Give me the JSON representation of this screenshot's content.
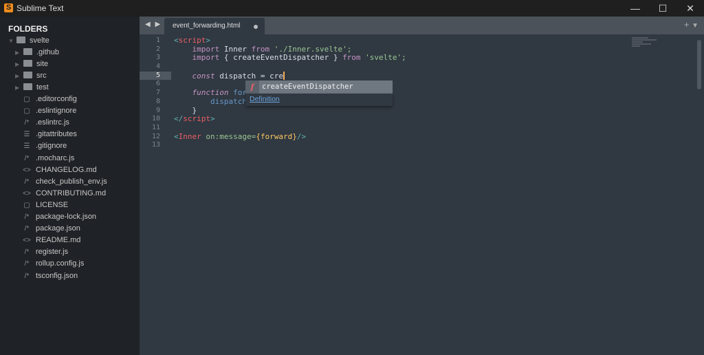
{
  "window": {
    "title": "Sublime Text",
    "minimize": "—",
    "maximize": "☐",
    "close": "✕"
  },
  "sidebar": {
    "header": "FOLDERS",
    "root": "svelte",
    "folders": [
      ".github",
      "site",
      "src",
      "test"
    ],
    "files": [
      {
        "name": ".editorconfig",
        "icon": "file-icon"
      },
      {
        "name": ".eslintignore",
        "icon": "file-icon"
      },
      {
        "name": ".eslintrc.js",
        "icon": "comment-icon"
      },
      {
        "name": ".gitattributes",
        "icon": "list-icon"
      },
      {
        "name": ".gitignore",
        "icon": "list-icon"
      },
      {
        "name": ".mocharc.js",
        "icon": "comment-icon"
      },
      {
        "name": "CHANGELOG.md",
        "icon": "code-icon"
      },
      {
        "name": "check_publish_env.js",
        "icon": "comment-icon"
      },
      {
        "name": "CONTRIBUTING.md",
        "icon": "code-icon"
      },
      {
        "name": "LICENSE",
        "icon": "file-icon"
      },
      {
        "name": "package-lock.json",
        "icon": "comment-icon"
      },
      {
        "name": "package.json",
        "icon": "comment-icon"
      },
      {
        "name": "README.md",
        "icon": "code-icon"
      },
      {
        "name": "register.js",
        "icon": "comment-icon"
      },
      {
        "name": "rollup.config.js",
        "icon": "comment-icon"
      },
      {
        "name": "tsconfig.json",
        "icon": "comment-icon"
      }
    ]
  },
  "tabs": {
    "nav": "◀ ▶",
    "active": "event_forwarding.html",
    "add": "+",
    "menu": "▼"
  },
  "editor": {
    "line_numbers": [
      "1",
      "2",
      "3",
      "4",
      "5",
      "6",
      "7",
      "8",
      "9",
      "10",
      "11",
      "12",
      "13"
    ],
    "current_line": "5",
    "code": {
      "l1": [
        "<",
        "script",
        ">"
      ],
      "l2": [
        "    ",
        "import",
        " Inner ",
        "from",
        " './Inner.svelte';"
      ],
      "l3": [
        "    ",
        "import",
        " { createEventDispatcher } ",
        "from",
        " 'svelte';"
      ],
      "l5": [
        "    ",
        "const",
        " dispatch = cre"
      ],
      "l7": [
        "    ",
        "function",
        " ",
        "forw"
      ],
      "l8": [
        "        dispatch("
      ],
      "l9": [
        "    }"
      ],
      "l10": [
        "</",
        "script",
        ">"
      ],
      "l12": [
        "<",
        "Inner",
        " on:message=",
        "{forward}",
        "/>"
      ]
    }
  },
  "autocomplete": {
    "kind": "f",
    "item": "createEventDispatcher",
    "link": "Definition"
  }
}
